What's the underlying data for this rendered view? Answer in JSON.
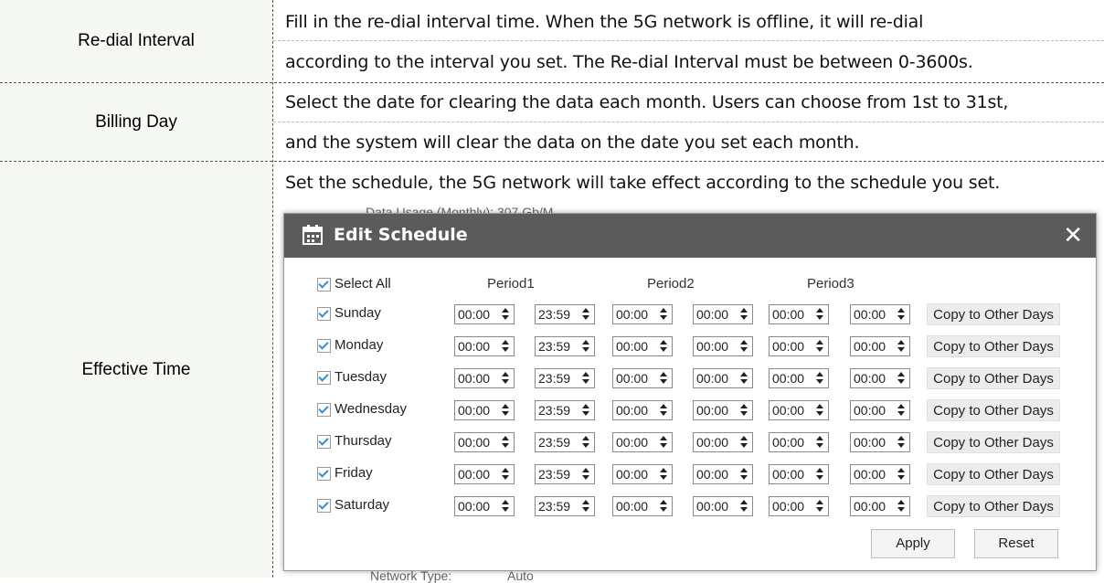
{
  "rows": [
    {
      "label": "Re-dial Interval",
      "lines": [
        "Fill in the re-dial interval time. When the 5G network is offline, it will re-dial",
        "according to the interval you set. The Re-dial Interval must be between 0-3600s."
      ]
    },
    {
      "label": "Billing Day",
      "lines": [
        "Select the date for clearing the data each month. Users can choose from 1st to 31st,",
        "and the system will clear the data on the date you set each month."
      ]
    },
    {
      "label": "Effective Time",
      "lines": [
        "Set the schedule, the 5G network will take effect according to the schedule you set."
      ]
    }
  ],
  "background": {
    "top_text": "Data Usage (Monthly): 307 Gb/M",
    "bottom_label": "Network Type:",
    "bottom_value": "Auto"
  },
  "dialog": {
    "title": "Edit Schedule",
    "close_icon": "close-icon",
    "calendar_icon": "calendar-icon",
    "select_all_label": "Select All",
    "periods": [
      "Period1",
      "Period2",
      "Period3"
    ],
    "copy_label": "Copy to Other Days",
    "days": [
      {
        "name": "Sunday",
        "times": [
          "00:00",
          "23:59",
          "00:00",
          "00:00",
          "00:00",
          "00:00"
        ]
      },
      {
        "name": "Monday",
        "times": [
          "00:00",
          "23:59",
          "00:00",
          "00:00",
          "00:00",
          "00:00"
        ]
      },
      {
        "name": "Tuesday",
        "times": [
          "00:00",
          "23:59",
          "00:00",
          "00:00",
          "00:00",
          "00:00"
        ]
      },
      {
        "name": "Wednesday",
        "times": [
          "00:00",
          "23:59",
          "00:00",
          "00:00",
          "00:00",
          "00:00"
        ]
      },
      {
        "name": "Thursday",
        "times": [
          "00:00",
          "23:59",
          "00:00",
          "00:00",
          "00:00",
          "00:00"
        ]
      },
      {
        "name": "Friday",
        "times": [
          "00:00",
          "23:59",
          "00:00",
          "00:00",
          "00:00",
          "00:00"
        ]
      },
      {
        "name": "Saturday",
        "times": [
          "00:00",
          "23:59",
          "00:00",
          "00:00",
          "00:00",
          "00:00"
        ]
      }
    ],
    "apply_label": "Apply",
    "reset_label": "Reset"
  },
  "colors": {
    "header_bg": "#5b5b5b",
    "check_accent": "#2f8fd8",
    "label_cell_bg": "#f6f9f3"
  }
}
